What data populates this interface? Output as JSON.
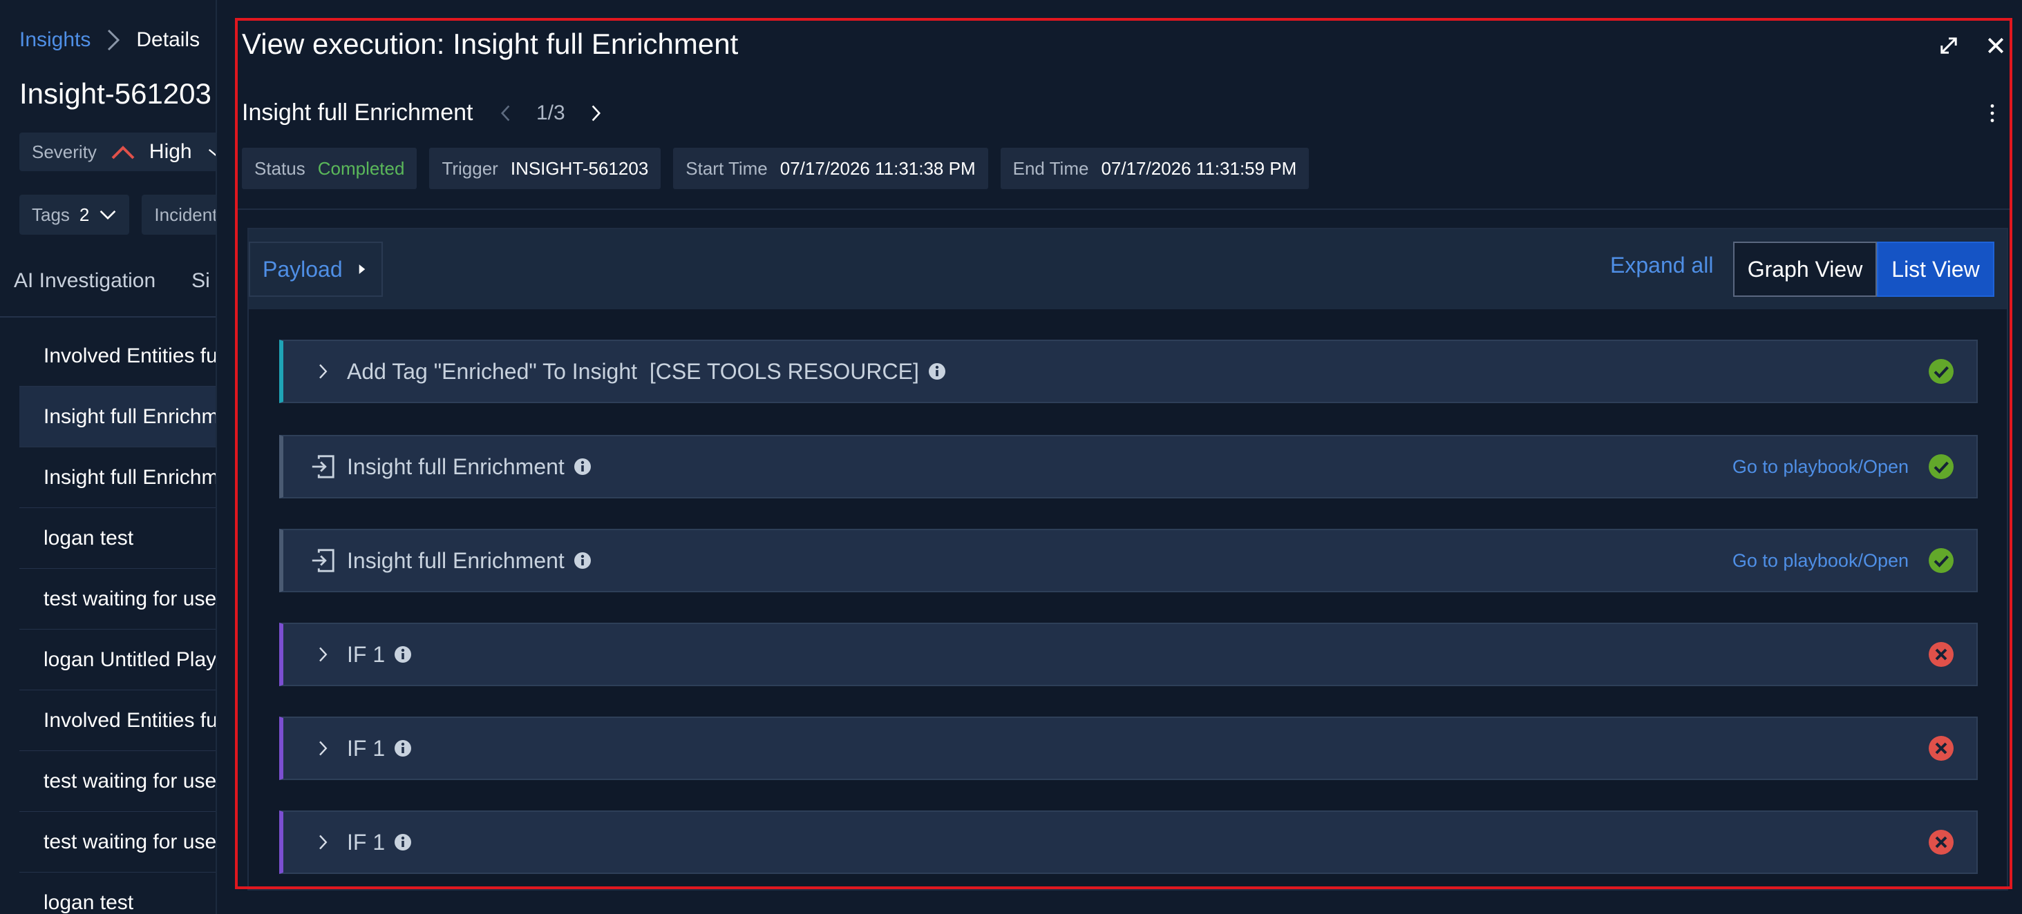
{
  "background_page": {
    "breadcrumb": {
      "link": "Insights",
      "current": "Details"
    },
    "title": "Insight-561203",
    "severity": {
      "label": "Severity",
      "value": "High"
    },
    "tags": {
      "label": "Tags",
      "count": "2"
    },
    "incident_chip": "Incident",
    "tabs": [
      "AI Investigation",
      "Si"
    ],
    "list_items": [
      "Involved Entities fu",
      "Insight full Enrichm",
      "Insight full Enrichm",
      "logan test",
      "test waiting for use",
      "logan Untitled Play",
      "Involved Entities fu",
      "test waiting for use",
      "test waiting for use",
      "logan test"
    ]
  },
  "modal": {
    "title": "View execution: Insight full Enrichment",
    "playbook_name": "Insight full Enrichment",
    "pager": "1/3",
    "meta": {
      "status_label": "Status",
      "status_value": "Completed",
      "trigger_label": "Trigger",
      "trigger_value": "INSIGHT-561203",
      "start_label": "Start Time",
      "start_value": "07/17/2026 11:31:38 PM",
      "end_label": "End Time",
      "end_value": "07/17/2026 11:31:59 PM"
    },
    "toolbar": {
      "payload_label": "Payload",
      "expand_all_label": "Expand all",
      "graph_view_label": "Graph View",
      "list_view_label": "List View"
    },
    "steps": [
      {
        "label": "Add Tag \"Enriched\" To Insight  [CSE TOOLS RESOURCE]",
        "kind": "action",
        "status": "success"
      },
      {
        "label": "Insight full Enrichment",
        "kind": "playbook",
        "link": "Go to playbook/Open",
        "status": "success"
      },
      {
        "label": "Insight full Enrichment",
        "kind": "playbook",
        "link": "Go to playbook/Open",
        "status": "success"
      },
      {
        "label": "IF 1",
        "kind": "condition",
        "status": "failed"
      },
      {
        "label": "IF 1",
        "kind": "condition",
        "status": "failed"
      },
      {
        "label": "IF 1",
        "kind": "condition",
        "status": "failed"
      }
    ]
  },
  "colors": {
    "accent_blue": "#4f8fe6",
    "success_green": "#62a82a",
    "failed_red": "#e0514a",
    "highlight_red": "#e0171f"
  }
}
